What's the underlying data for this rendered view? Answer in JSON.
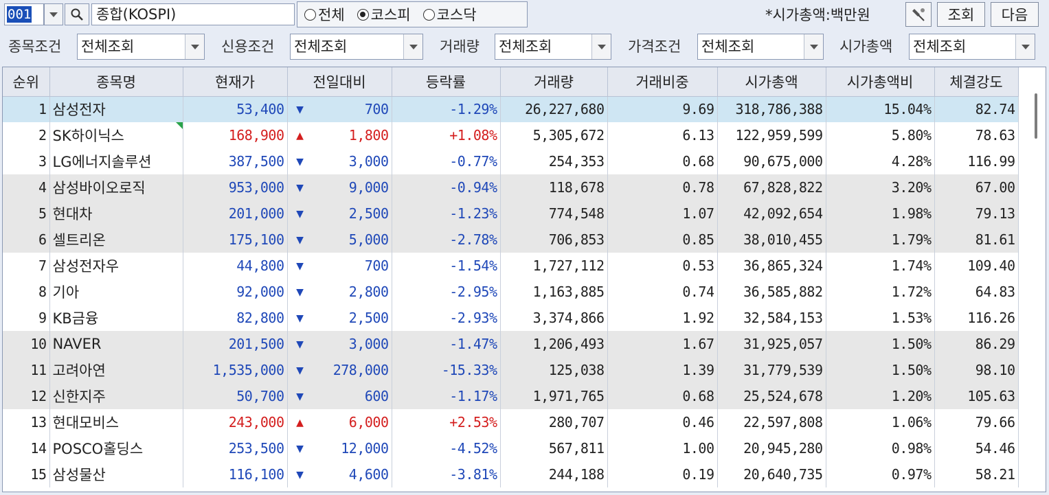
{
  "toolbar": {
    "code": "001",
    "market_name": "종합(KOSPI)",
    "radios": [
      {
        "label": "전체",
        "checked": false
      },
      {
        "label": "코스피",
        "checked": true
      },
      {
        "label": "코스닥",
        "checked": false
      }
    ],
    "unit_note": "*시가총액:백만원",
    "settings_icon": "pin-settings-icon",
    "query_label": "조회",
    "next_label": "다음"
  },
  "filters": {
    "stock_cond": {
      "label": "종목조건",
      "value": "전체조회"
    },
    "credit_cond": {
      "label": "신용조건",
      "value": "전체조회"
    },
    "volume_cond": {
      "label": "거래량",
      "value": "전체조회"
    },
    "price_cond": {
      "label": "가격조건",
      "value": "전체조회"
    },
    "cap_cond": {
      "label": "시가총액",
      "value": "전체조회"
    }
  },
  "table": {
    "headers": [
      "순위",
      "종목명",
      "현재가",
      "전일대비",
      "등락률",
      "거래량",
      "거래비중",
      "시가총액",
      "시가총액비",
      "체결강도"
    ],
    "rows": [
      {
        "rank": "1",
        "name": "삼성전자",
        "price": "53,400",
        "dir": "down",
        "change": "700",
        "rate": "-1.29%",
        "volume": "26,227,680",
        "vol_share": "9.69",
        "mcap": "318,786,388",
        "mcap_share": "15.04%",
        "strength": "82.74",
        "bg": "sel"
      },
      {
        "rank": "2",
        "name": "SK하이닉스",
        "price": "168,900",
        "dir": "up",
        "change": "1,800",
        "rate": "+1.08%",
        "volume": "5,305,672",
        "vol_share": "6.13",
        "mcap": "122,959,599",
        "mcap_share": "5.80%",
        "strength": "78.63",
        "bg": "white",
        "mark": true
      },
      {
        "rank": "3",
        "name": "LG에너지솔루션",
        "price": "387,500",
        "dir": "down",
        "change": "3,000",
        "rate": "-0.77%",
        "volume": "254,353",
        "vol_share": "0.68",
        "mcap": "90,675,000",
        "mcap_share": "4.28%",
        "strength": "116.99",
        "bg": "white"
      },
      {
        "rank": "4",
        "name": "삼성바이오로직",
        "price": "953,000",
        "dir": "down",
        "change": "9,000",
        "rate": "-0.94%",
        "volume": "118,678",
        "vol_share": "0.78",
        "mcap": "67,828,822",
        "mcap_share": "3.20%",
        "strength": "67.00",
        "bg": "gray"
      },
      {
        "rank": "5",
        "name": "현대차",
        "price": "201,000",
        "dir": "down",
        "change": "2,500",
        "rate": "-1.23%",
        "volume": "774,548",
        "vol_share": "1.07",
        "mcap": "42,092,654",
        "mcap_share": "1.98%",
        "strength": "79.13",
        "bg": "gray"
      },
      {
        "rank": "6",
        "name": "셀트리온",
        "price": "175,100",
        "dir": "down",
        "change": "5,000",
        "rate": "-2.78%",
        "volume": "706,853",
        "vol_share": "0.85",
        "mcap": "38,010,455",
        "mcap_share": "1.79%",
        "strength": "81.61",
        "bg": "gray"
      },
      {
        "rank": "7",
        "name": "삼성전자우",
        "price": "44,800",
        "dir": "down",
        "change": "700",
        "rate": "-1.54%",
        "volume": "1,727,112",
        "vol_share": "0.53",
        "mcap": "36,865,324",
        "mcap_share": "1.74%",
        "strength": "109.40",
        "bg": "white"
      },
      {
        "rank": "8",
        "name": "기아",
        "price": "92,000",
        "dir": "down",
        "change": "2,800",
        "rate": "-2.95%",
        "volume": "1,163,885",
        "vol_share": "0.74",
        "mcap": "36,585,882",
        "mcap_share": "1.72%",
        "strength": "64.83",
        "bg": "white"
      },
      {
        "rank": "9",
        "name": "KB금융",
        "price": "82,800",
        "dir": "down",
        "change": "2,500",
        "rate": "-2.93%",
        "volume": "3,374,866",
        "vol_share": "1.92",
        "mcap": "32,584,153",
        "mcap_share": "1.53%",
        "strength": "116.26",
        "bg": "white"
      },
      {
        "rank": "10",
        "name": "NAVER",
        "price": "201,500",
        "dir": "down",
        "change": "3,000",
        "rate": "-1.47%",
        "volume": "1,206,493",
        "vol_share": "1.67",
        "mcap": "31,925,057",
        "mcap_share": "1.50%",
        "strength": "86.29",
        "bg": "gray"
      },
      {
        "rank": "11",
        "name": "고려아연",
        "price": "1,535,000",
        "dir": "down",
        "change": "278,000",
        "rate": "-15.33%",
        "volume": "125,038",
        "vol_share": "1.39",
        "mcap": "31,779,539",
        "mcap_share": "1.50%",
        "strength": "98.10",
        "bg": "gray"
      },
      {
        "rank": "12",
        "name": "신한지주",
        "price": "50,700",
        "dir": "down",
        "change": "600",
        "rate": "-1.17%",
        "volume": "1,971,765",
        "vol_share": "0.68",
        "mcap": "25,524,678",
        "mcap_share": "1.20%",
        "strength": "105.63",
        "bg": "gray"
      },
      {
        "rank": "13",
        "name": "현대모비스",
        "price": "243,000",
        "dir": "up",
        "change": "6,000",
        "rate": "+2.53%",
        "volume": "280,707",
        "vol_share": "0.46",
        "mcap": "22,597,808",
        "mcap_share": "1.06%",
        "strength": "79.66",
        "bg": "white"
      },
      {
        "rank": "14",
        "name": "POSCO홀딩스",
        "price": "253,500",
        "dir": "down",
        "change": "12,000",
        "rate": "-4.52%",
        "volume": "567,811",
        "vol_share": "1.00",
        "mcap": "20,945,280",
        "mcap_share": "0.98%",
        "strength": "54.46",
        "bg": "white"
      },
      {
        "rank": "15",
        "name": "삼성물산",
        "price": "116,100",
        "dir": "down",
        "change": "4,600",
        "rate": "-3.81%",
        "volume": "244,188",
        "vol_share": "0.19",
        "mcap": "20,640,735",
        "mcap_share": "0.97%",
        "strength": "58.21",
        "bg": "white"
      }
    ]
  },
  "colors": {
    "up": "#d41e1e",
    "down": "#1f48b8",
    "selected_row": "#cfe6f3",
    "group_row": "#e7e7e7"
  }
}
